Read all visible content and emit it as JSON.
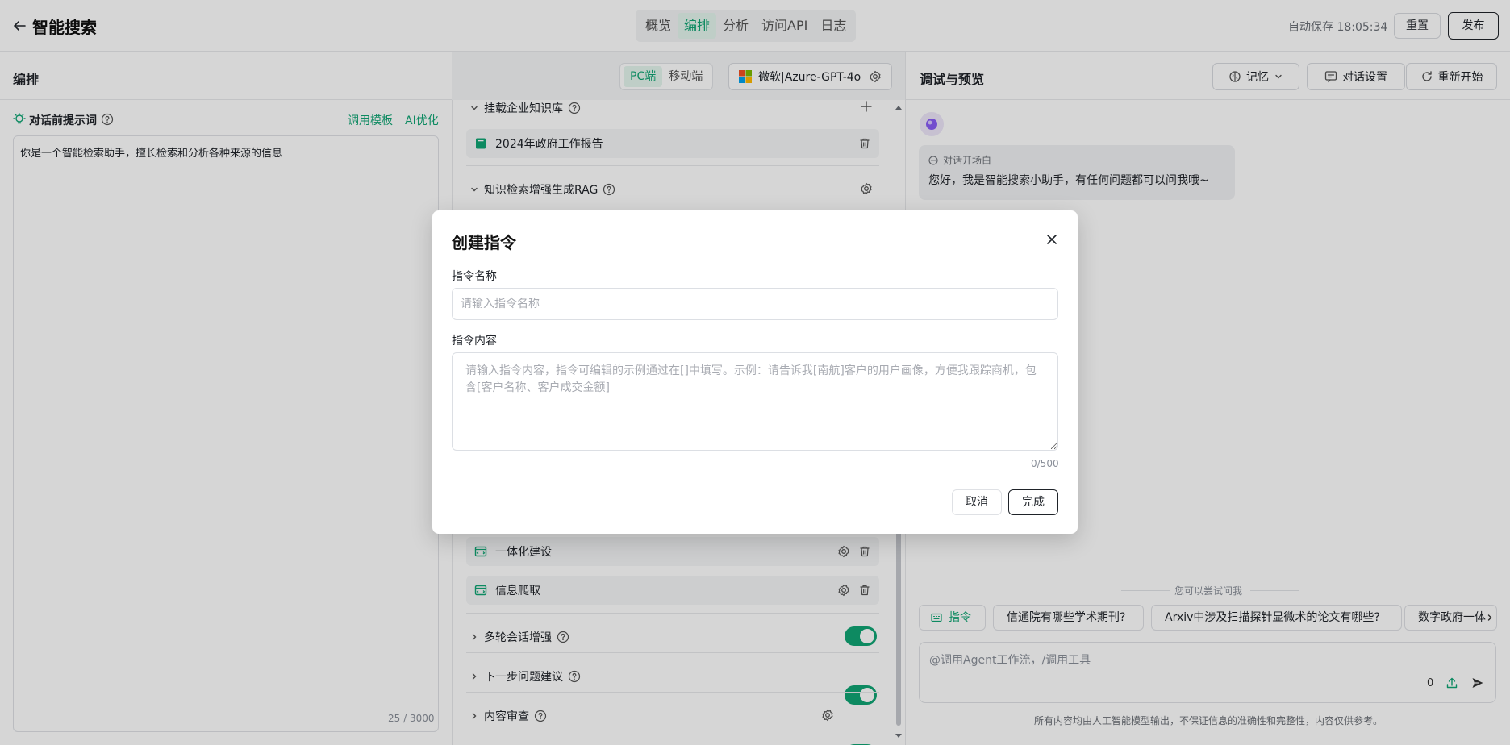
{
  "header": {
    "title": "智能搜索",
    "tabs": [
      "概览",
      "编排",
      "分析",
      "访问API",
      "日志"
    ],
    "active_tab": "编排",
    "autosave": "自动保存 18:05:34",
    "reset_label": "重置",
    "publish_label": "发布"
  },
  "left": {
    "title": "编排",
    "prompt_label": "对话前提示词",
    "template_link": "调用模板",
    "ai_optimize_link": "AI优化",
    "prompt_text": "你是一个智能检索助手，擅长检索和分析各种来源的信息",
    "prompt_count": "25 / 3000"
  },
  "middle": {
    "device_tabs": [
      "PC端",
      "移动端"
    ],
    "active_device": "PC端",
    "model_name": "微软|Azure-GPT-4o",
    "sections": {
      "knowledge": "挂载企业知识库",
      "kb_item": "2024年政府工作报告",
      "rag": "知识检索增强生成RAG",
      "multi_turn": "多轮会话增强",
      "next_suggest": "下一步问题建议",
      "review": "内容审查"
    },
    "tools": [
      "一体化建设",
      "信息爬取"
    ],
    "toggles": {
      "multi_turn": true,
      "next_suggest": true,
      "review": true
    }
  },
  "right": {
    "title": "调试与预览",
    "memory_label": "记忆",
    "chat_settings_label": "对话设置",
    "restart_label": "重新开始",
    "opening_label": "对话开场白",
    "opening_text": "您好，我是智能搜索小助手，有任何问题都可以问我哦~",
    "try_label": "您可以尝试问我",
    "instruction_chip": "指令",
    "suggestions": [
      "信通院有哪些学术期刊?",
      "Arxiv中涉及扫描探针显微术的论文有哪些?",
      "数字政府一体"
    ],
    "input_placeholder": "@调用Agent工作流，/调用工具",
    "input_count": "0",
    "disclaimer": "所有内容均由人工智能模型输出，不保证信息的准确性和完整性，内容仅供参考。"
  },
  "modal": {
    "title": "创建指令",
    "name_label": "指令名称",
    "name_placeholder": "请输入指令名称",
    "content_label": "指令内容",
    "content_placeholder": "请输入指令内容，指令可编辑的示例通过在[]中填写。示例：请告诉我[南航]客户的用户画像，方便我跟踪商机，包含[客户名称、客户成交金额]",
    "char_count": "0/500",
    "cancel_label": "取消",
    "done_label": "完成"
  },
  "colors": {
    "accent": "#10a574",
    "text": "#1f2329",
    "muted": "#8a8f99"
  }
}
